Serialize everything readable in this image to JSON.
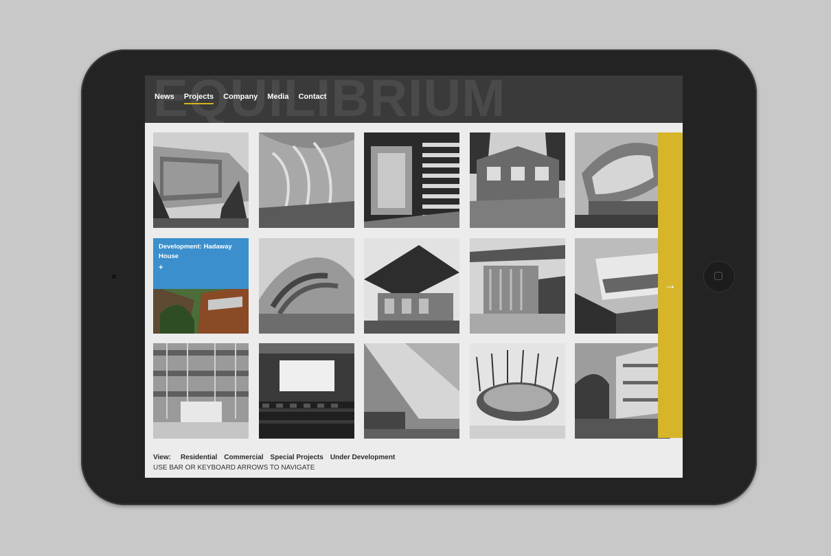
{
  "brand": {
    "watermark": "EQUILIBRIUM"
  },
  "nav": {
    "items": [
      {
        "label": "News",
        "active": false
      },
      {
        "label": "Projects",
        "active": true
      },
      {
        "label": "Company",
        "active": false
      },
      {
        "label": "Media",
        "active": false
      },
      {
        "label": "Contact",
        "active": false
      }
    ],
    "accent_color": "#d8b21a"
  },
  "grid": {
    "hover_card": {
      "title": "Development: Hadaway House",
      "action": "+",
      "color": "#3a8fcc"
    }
  },
  "next_bar": {
    "arrow": "→",
    "color": "#d6b52a"
  },
  "filters": {
    "label": "View:",
    "items": [
      "Residential",
      "Commercial",
      "Special Projects",
      "Under Development"
    ]
  },
  "hint": "USE BAR OR KEYBOARD ARROWS TO NAVIGATE"
}
